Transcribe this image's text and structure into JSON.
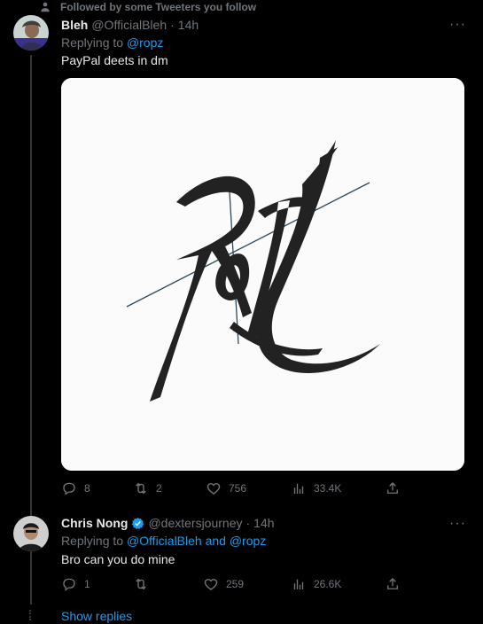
{
  "social_context": {
    "text": "Followed by some Tweeters you follow"
  },
  "tweets": [
    {
      "name": "Bleh",
      "handle": "@OfficialBleh",
      "separator": "·",
      "time": "14h",
      "reply_prefix": "Replying to",
      "reply_mentions": "@ropz",
      "text": "PayPal deets in dm",
      "more": "···",
      "stats": {
        "replies": "8",
        "retweets": "2",
        "likes": "756",
        "views": "33.4K"
      }
    },
    {
      "name": "Chris Nong",
      "handle": "@dextersjourney",
      "separator": "·",
      "time": "14h",
      "reply_prefix": "Replying to",
      "reply_mentions": "@OfficialBleh and @ropz",
      "text": "Bro can you do mine",
      "more": "···",
      "stats": {
        "replies": "1",
        "retweets": "",
        "likes": "259",
        "views": "26.6K"
      }
    }
  ],
  "show_replies": "Show replies",
  "colors": {
    "background": "#000000",
    "text": "#e7e9ea",
    "muted": "#71767b",
    "accent": "#1d9bf0",
    "verified": "#1d9bf0"
  },
  "icons": [
    "person-icon",
    "more-icon",
    "reply-icon",
    "retweet-icon",
    "like-icon",
    "views-icon",
    "share-icon",
    "verified-icon"
  ]
}
